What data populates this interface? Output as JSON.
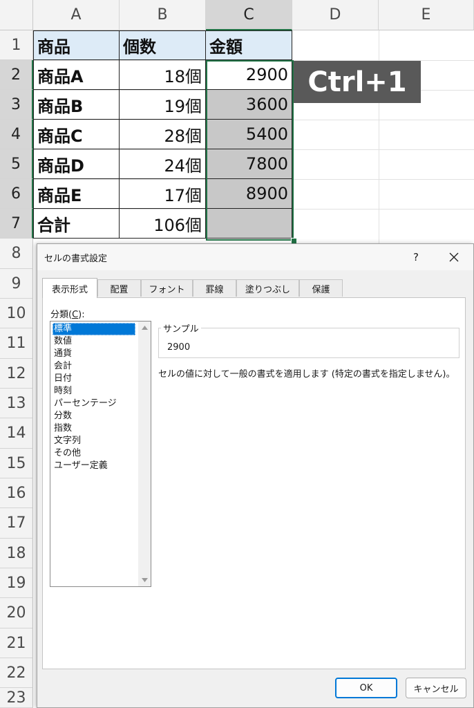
{
  "sheet": {
    "columns": [
      "A",
      "B",
      "C",
      "D",
      "E"
    ],
    "rows": [
      "1",
      "2",
      "3",
      "4",
      "5",
      "6",
      "7",
      "8",
      "9",
      "10",
      "11",
      "12",
      "13",
      "14",
      "15",
      "16",
      "17",
      "18",
      "19",
      "20",
      "21",
      "22",
      "23"
    ],
    "header": [
      "商品",
      "個数",
      "金額"
    ],
    "data": [
      [
        "商品A",
        "18個",
        "2900"
      ],
      [
        "商品B",
        "19個",
        "3600"
      ],
      [
        "商品C",
        "28個",
        "5400"
      ],
      [
        "商品D",
        "24個",
        "7800"
      ],
      [
        "商品E",
        "17個",
        "8900"
      ],
      [
        "合計",
        "106個",
        ""
      ]
    ],
    "selected_column": "C",
    "colors": {
      "header_fill": "#ddebf7",
      "selection_fill": "#c8c8c8",
      "selection_border": "#217346"
    }
  },
  "shortcut_label": "Ctrl+1",
  "dialog": {
    "title": "セルの書式設定",
    "help_label": "?",
    "close_icon": "close-icon",
    "tabs": [
      "表示形式",
      "配置",
      "フォント",
      "罫線",
      "塗りつぶし",
      "保護"
    ],
    "active_tab": "表示形式",
    "category_label_prefix": "分類(",
    "category_label_key": "C",
    "category_label_suffix": "):",
    "categories": [
      "標準",
      "数値",
      "通貨",
      "会計",
      "日付",
      "時刻",
      "パーセンテージ",
      "分数",
      "指数",
      "文字列",
      "その他",
      "ユーザー定義"
    ],
    "selected_category": "標準",
    "sample_label": "サンプル",
    "sample_value": "2900",
    "description": "セルの値に対して一般の書式を適用します (特定の書式を指定しません)。",
    "ok_label": "OK",
    "cancel_label": "キャンセル",
    "accent_color": "#0078d7"
  }
}
